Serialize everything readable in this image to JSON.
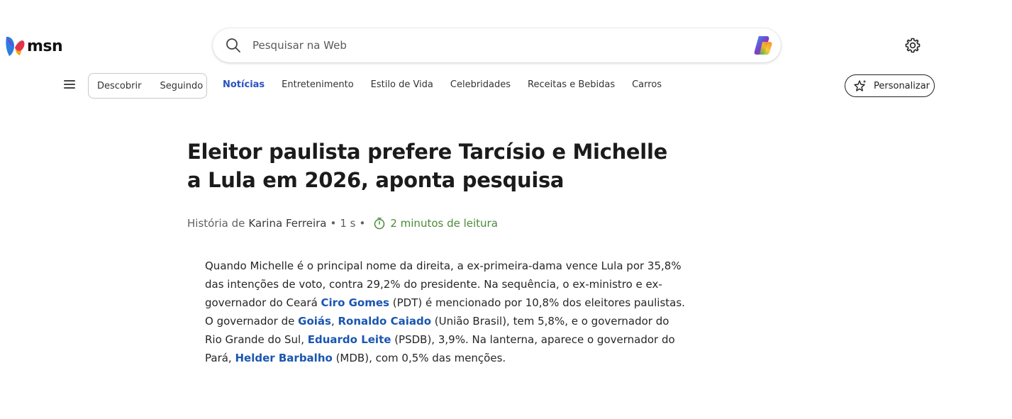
{
  "header": {
    "logo_text": "msn",
    "search_placeholder": "Pesquisar na Web"
  },
  "nav": {
    "pill_items": [
      "Descobrir",
      "Seguindo"
    ],
    "items": [
      {
        "label": "Notícias",
        "active": true
      },
      {
        "label": "Entretenimento",
        "active": false
      },
      {
        "label": "Estilo de Vida",
        "active": false
      },
      {
        "label": "Celebridades",
        "active": false
      },
      {
        "label": "Receitas e Bebidas",
        "active": false
      },
      {
        "label": "Carros",
        "active": false
      }
    ],
    "personalize_label": "Personalizar"
  },
  "article": {
    "title": "Eleitor paulista prefere Tarcísio e Michelle a Lula em 2026, aponta pesquisa",
    "byline_prefix": "História de",
    "author": "Karina Ferreira",
    "time": "1 s",
    "read_time": "2 minutos de leitura",
    "paragraph": [
      {
        "text": "Quando Michelle é o principal nome da direita, a ex-primeira-dama vence Lula por 35,8% das intenções de voto, contra 29,2% do presidente. Na sequência, o ex-ministro e ex-governador do Ceará "
      },
      {
        "text": "Ciro Gomes",
        "link": true
      },
      {
        "text": " (PDT) é mencionado por 10,8% dos eleitores paulistas. O governador de "
      },
      {
        "text": "Goiás",
        "link": true
      },
      {
        "text": ", "
      },
      {
        "text": "Ronaldo Caiado",
        "link": true
      },
      {
        "text": " (União Brasil), tem 5,8%, e o governador do Rio Grande do Sul, "
      },
      {
        "text": "Eduardo Leite",
        "link": true
      },
      {
        "text": " (PSDB), 3,9%. Na lanterna, aparece o governador do Pará, "
      },
      {
        "text": "Helder Barbalho",
        "link": true
      },
      {
        "text": " (MDB), com 0,5% das menções."
      }
    ]
  },
  "colors": {
    "accent": "#2a52be",
    "link": "#1a56b0",
    "read_time": "#4a8a3a"
  },
  "icons": {
    "search": "search-icon",
    "copilot": "copilot-icon",
    "settings": "gear-icon",
    "menu": "hamburger-icon",
    "personalize": "sparkle-star-icon",
    "timer": "stopwatch-icon"
  }
}
